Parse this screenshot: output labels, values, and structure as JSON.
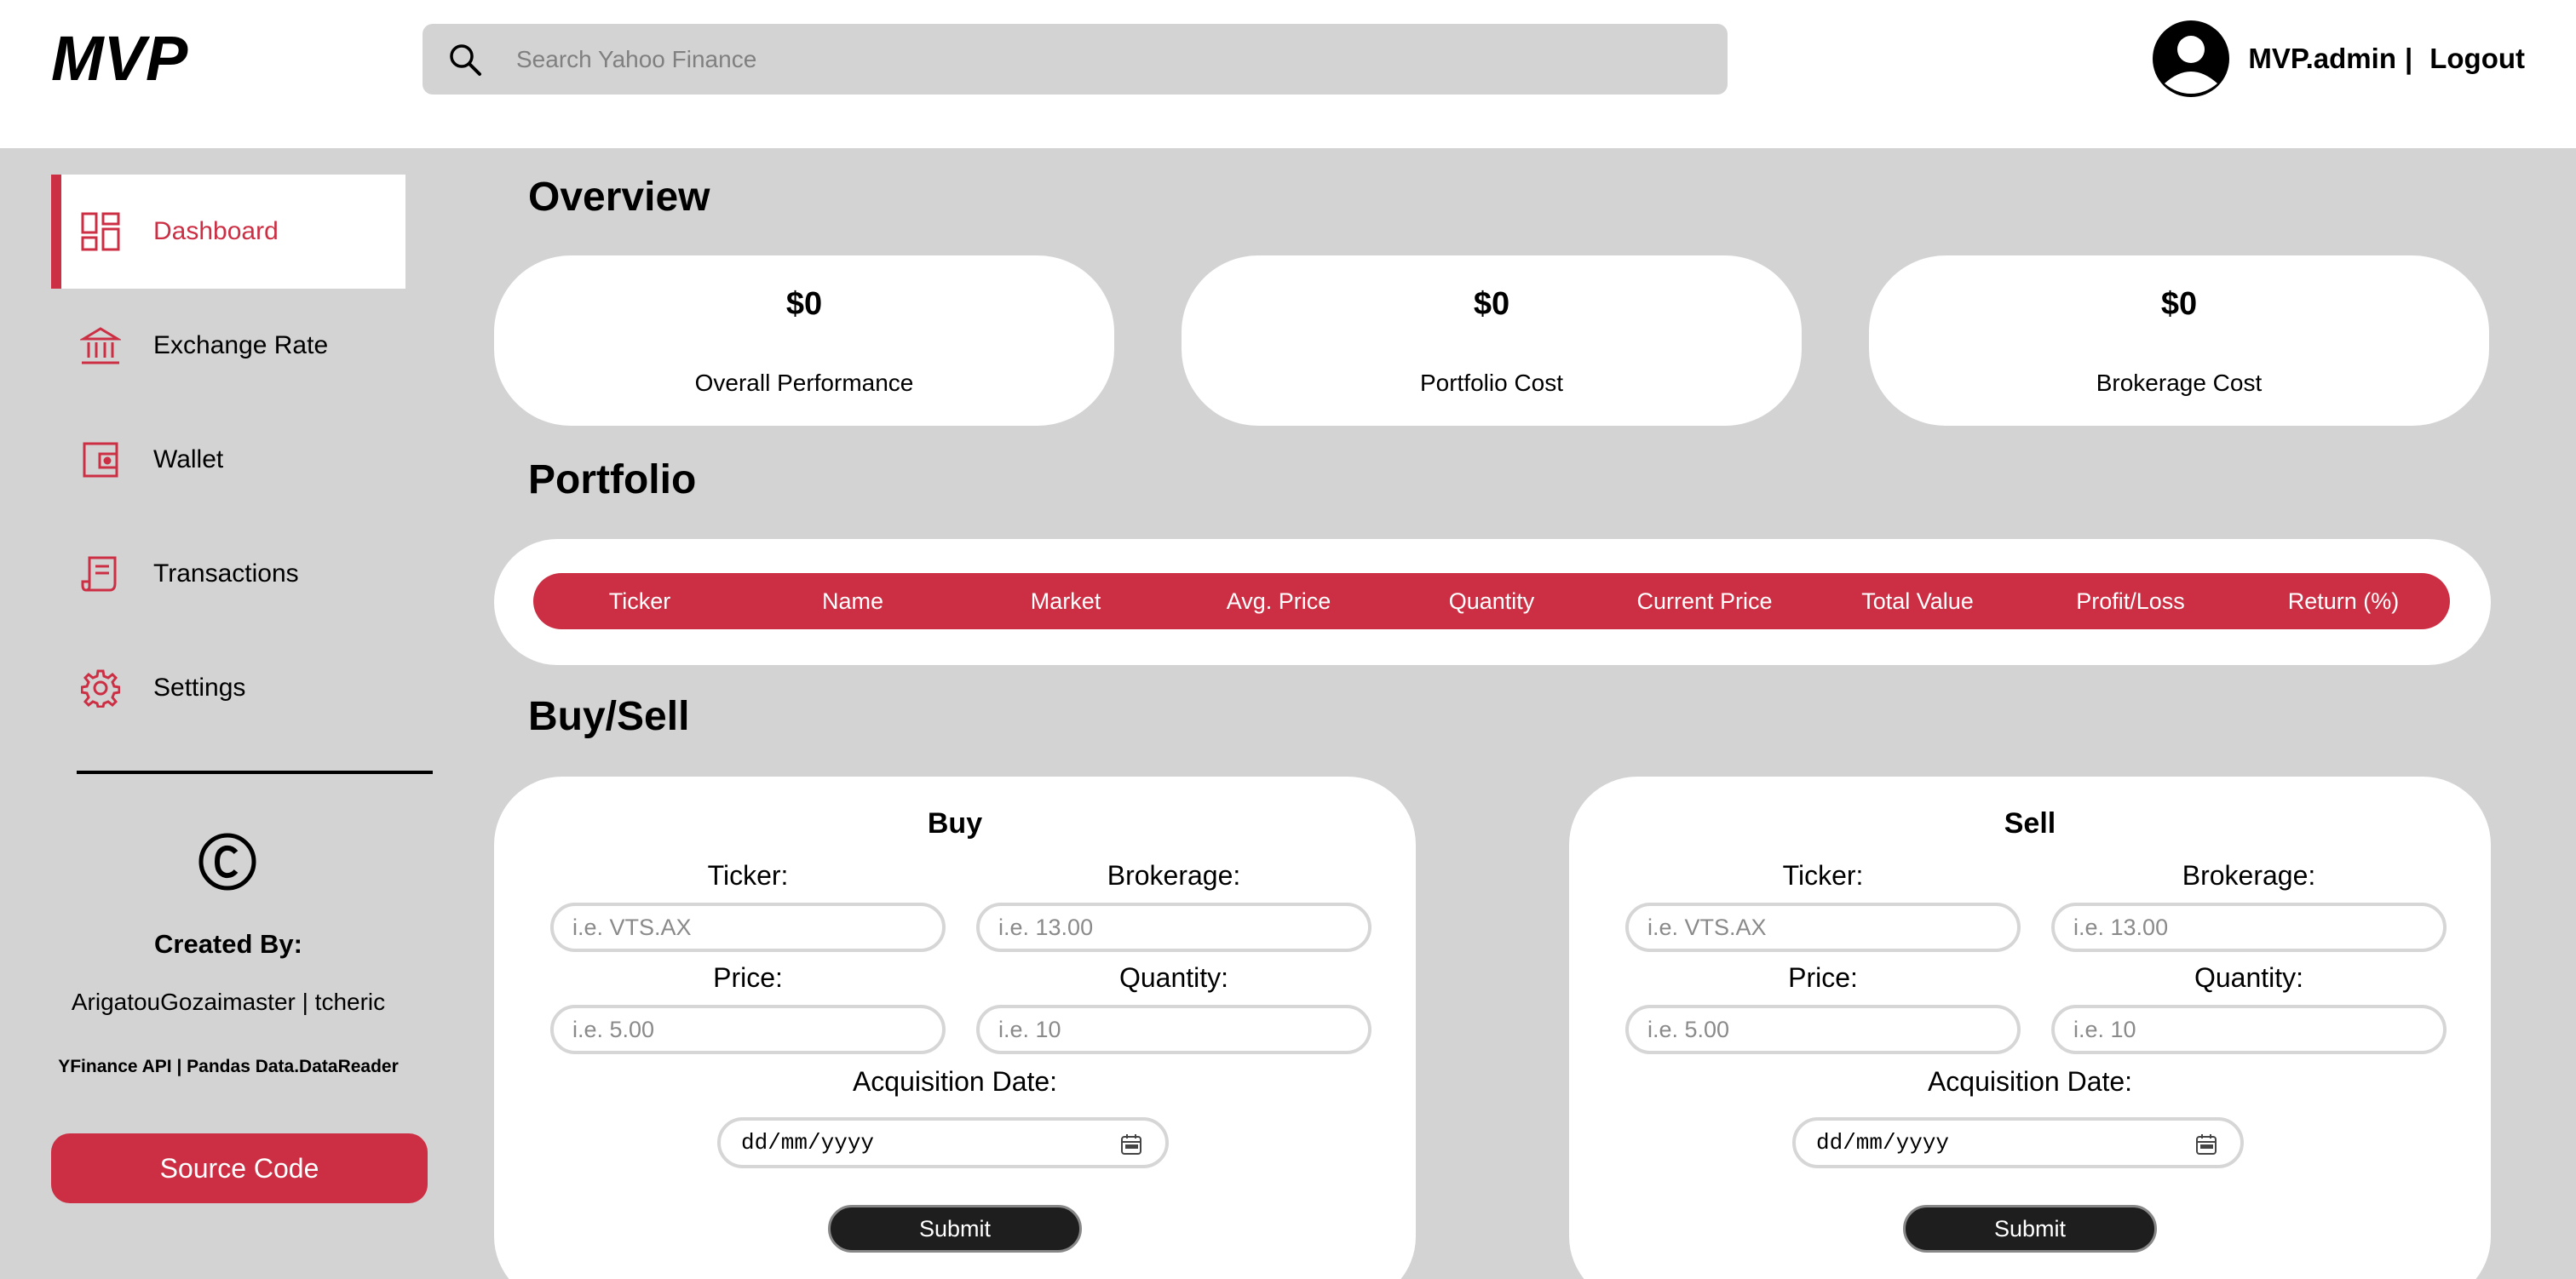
{
  "header": {
    "logo_text": "MVP",
    "search_placeholder": "Search Yahoo Finance",
    "user_name": "MVP.admin",
    "separator": "|",
    "logout_label": "Logout"
  },
  "sidebar": {
    "items": [
      {
        "label": "Dashboard",
        "icon": "dashboard-icon",
        "active": true
      },
      {
        "label": "Exchange Rate",
        "icon": "bank-icon",
        "active": false
      },
      {
        "label": "Wallet",
        "icon": "wallet-icon",
        "active": false
      },
      {
        "label": "Transactions",
        "icon": "receipt-icon",
        "active": false
      },
      {
        "label": "Settings",
        "icon": "gear-icon",
        "active": false
      }
    ],
    "created_by_label": "Created By:",
    "authors": "ArigatouGozaimaster | tcheric",
    "apis": "YFinance API | Pandas Data.DataReader",
    "source_button": "Source Code"
  },
  "overview": {
    "title": "Overview",
    "cards": [
      {
        "value": "$0",
        "label": "Overall Performance"
      },
      {
        "value": "$0",
        "label": "Portfolio Cost"
      },
      {
        "value": "$0",
        "label": "Brokerage Cost"
      }
    ]
  },
  "portfolio": {
    "title": "Portfolio",
    "columns": [
      "Ticker",
      "Name",
      "Market",
      "Avg. Price",
      "Quantity",
      "Current Price",
      "Total Value",
      "Profit/Loss",
      "Return (%)"
    ]
  },
  "buysell": {
    "title": "Buy/Sell",
    "buy": {
      "title": "Buy",
      "ticker_label": "Ticker:",
      "ticker_placeholder": "i.e. VTS.AX",
      "brokerage_label": "Brokerage:",
      "brokerage_placeholder": "i.e. 13.00",
      "price_label": "Price:",
      "price_placeholder": "i.e. 5.00",
      "quantity_label": "Quantity:",
      "quantity_placeholder": "i.e. 10",
      "date_label": "Acquisition Date:",
      "date_placeholder": "dd/mm/yyyy",
      "submit_label": "Submit"
    },
    "sell": {
      "title": "Sell",
      "ticker_label": "Ticker:",
      "ticker_placeholder": "i.e. VTS.AX",
      "brokerage_label": "Brokerage:",
      "brokerage_placeholder": "i.e. 13.00",
      "price_label": "Price:",
      "price_placeholder": "i.e. 5.00",
      "quantity_label": "Quantity:",
      "quantity_placeholder": "i.e. 10",
      "date_label": "Acquisition Date:",
      "date_placeholder": "dd/mm/yyyy",
      "submit_label": "Submit"
    }
  },
  "colors": {
    "accent": "#cc2f44",
    "background": "#d3d3d3",
    "card": "#ffffff"
  }
}
